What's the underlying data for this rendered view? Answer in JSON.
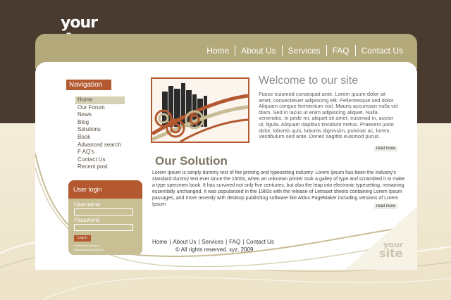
{
  "logo": {
    "line1": "your",
    "line2": "site"
  },
  "top_nav": {
    "items": [
      {
        "label": "Home"
      },
      {
        "label": "About Us"
      },
      {
        "label": "Services"
      },
      {
        "label": "FAQ"
      },
      {
        "label": "Contact Us"
      }
    ]
  },
  "sidebar": {
    "nav_title": "Navigation",
    "items": [
      {
        "label": "Home",
        "active": true
      },
      {
        "label": "Our Forum"
      },
      {
        "label": "News"
      },
      {
        "label": "Blog"
      },
      {
        "label": "Solutions"
      },
      {
        "label": "Book"
      },
      {
        "label": "Advanced search"
      },
      {
        "label": "F AQ's"
      },
      {
        "label": "Contact Us"
      },
      {
        "label": "Recent post"
      }
    ]
  },
  "login": {
    "title": "User login",
    "username_label": "Username:",
    "username_value": "",
    "password_label": "Password:",
    "password_value": "",
    "button_label": "Log in",
    "create_account": "Create new account",
    "request_password": "Request new password"
  },
  "welcome": {
    "title": "Welcome to our site",
    "text": "Fusce euismod consequat ante. Lorem ipsum dolor sit amet, consectetuer adipiscing elit. Pellentesque sed dolor. Aliquam congue fermentum nisl. Mauris accumsan nulla vel diam. Sed in lacus ut enim adipiscing aliquet. Nulla venenatis. In pede mi, aliquet sit amet, euismod in, auctor ut, ligula. Aliquam dapibus tincidunt metus. Praesent justo dolor, lobortis quis, lobortis dignissim, pulvinar ac, lorem. Vestibulum sed ante. Donec sagittis euismod purus.",
    "read_more": "read more"
  },
  "solution": {
    "title": "Our Solution",
    "text": "Lorem Ipsum is simply dummy text of the printing and typesetting industry. Lorem Ipsum has been the industry's standard dummy text ever since the 1500s, when an unknown printer took a galley of type and scrambled it to make a type specimen book. It has survived not only five centuries, but also the leap into electronic typesetting, remaining essentially unchanged. It was popularised in the 1960s with the release of Letraset sheets containing Lorem Ipsum passages, and more recently with desktop publishing software like Aldus PageMaker including versions of Lorem Ipsum",
    "read_more": "read more"
  },
  "footer": {
    "links": [
      {
        "label": "Home"
      },
      {
        "label": "About Us"
      },
      {
        "label": "Services"
      },
      {
        "label": "FAQ"
      },
      {
        "label": "Contact Us"
      }
    ],
    "copyright": "© All rights reserved. xyz. 2009"
  },
  "watermark": {
    "line1": "your",
    "line2": "site"
  },
  "colors": {
    "dark_brown": "#4a3b30",
    "tan": "#b3a97a",
    "rust": "#b3582f",
    "cream": "#efe6cf"
  }
}
